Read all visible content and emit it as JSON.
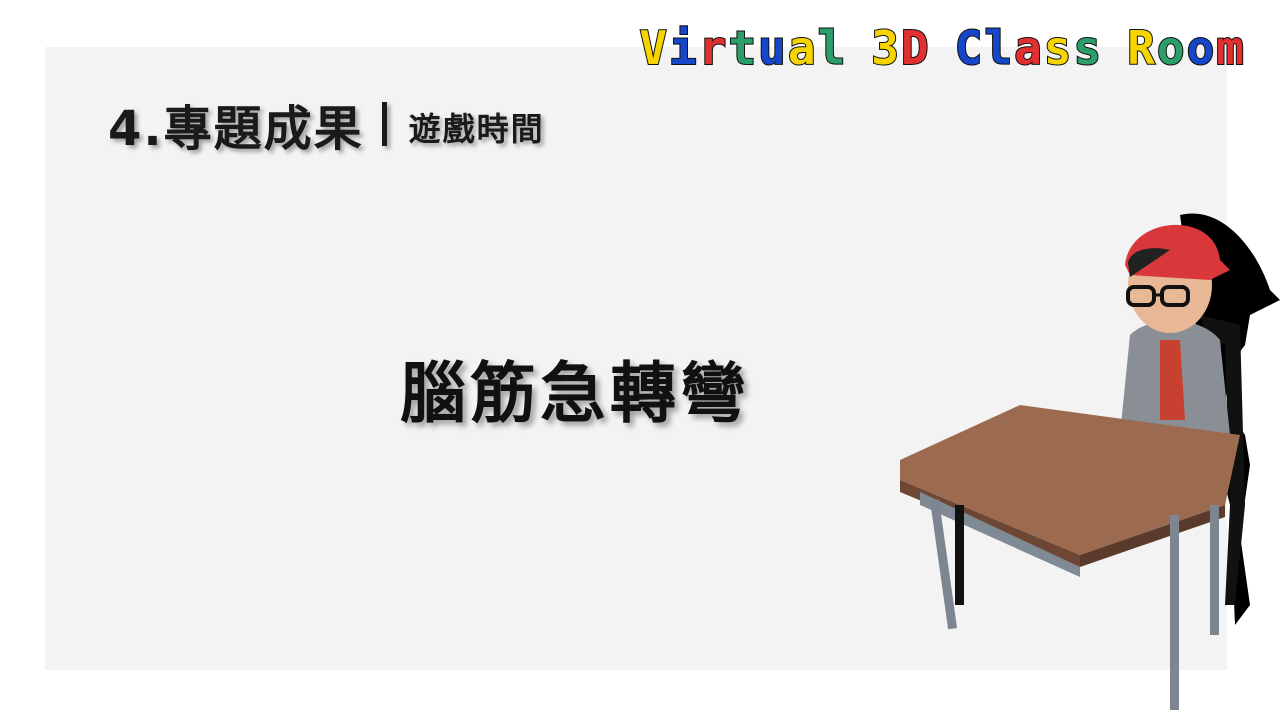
{
  "brand": {
    "words": [
      {
        "letters": [
          {
            "ch": "V",
            "color": "#f5d400"
          },
          {
            "ch": "i",
            "color": "#1747c9"
          },
          {
            "ch": "r",
            "color": "#e23030"
          },
          {
            "ch": "t",
            "color": "#2b9e6a"
          },
          {
            "ch": "u",
            "color": "#1747c9"
          },
          {
            "ch": "a",
            "color": "#f5d400"
          },
          {
            "ch": "l",
            "color": "#2b9e6a"
          }
        ]
      },
      {
        "letters": [
          {
            "ch": "3",
            "color": "#f5d400"
          },
          {
            "ch": "D",
            "color": "#e23030"
          }
        ]
      },
      {
        "letters": [
          {
            "ch": "C",
            "color": "#1747c9"
          },
          {
            "ch": "l",
            "color": "#1747c9"
          },
          {
            "ch": "a",
            "color": "#e23030"
          },
          {
            "ch": "s",
            "color": "#f5d400"
          },
          {
            "ch": "s",
            "color": "#2b9e6a"
          }
        ]
      },
      {
        "letters": [
          {
            "ch": "R",
            "color": "#f5d400"
          },
          {
            "ch": "o",
            "color": "#2b9e6a"
          },
          {
            "ch": "o",
            "color": "#1747c9"
          },
          {
            "ch": "m",
            "color": "#e23030"
          }
        ]
      }
    ]
  },
  "heading": {
    "main": "4.專題成果",
    "sub": "遊戲時間"
  },
  "topic": "腦筋急轉彎",
  "illustration": "student-at-desk-illustration"
}
